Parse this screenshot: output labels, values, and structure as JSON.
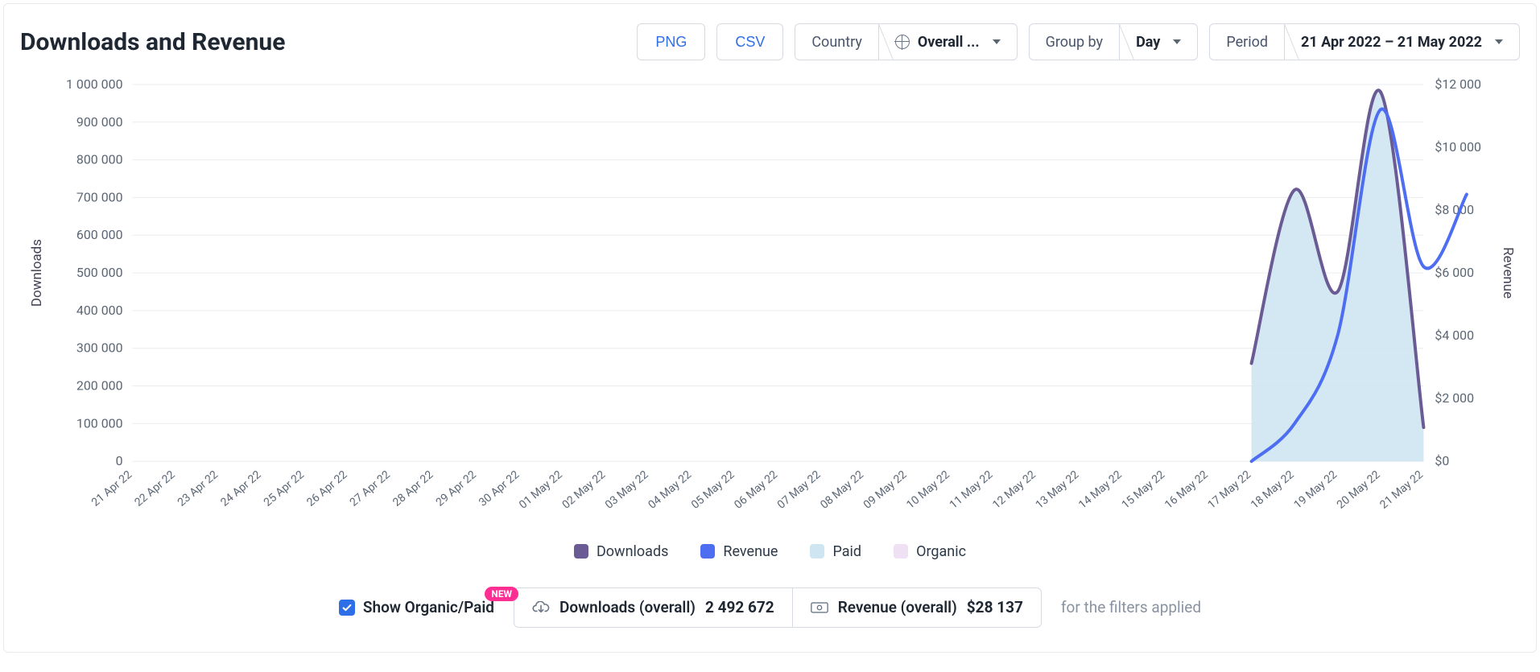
{
  "header": {
    "title": "Downloads and Revenue",
    "export_png": "PNG",
    "export_csv": "CSV",
    "country_label": "Country",
    "country_value": "Overall ...",
    "groupby_label": "Group by",
    "groupby_value": "Day",
    "period_label": "Period",
    "period_value": "21 Apr 2022 – 21 May 2022"
  },
  "chart_data": {
    "type": "line",
    "xlabel": "",
    "y_left_label": "Downloads",
    "y_right_label": "Revenue",
    "y_left_ticks": [
      0,
      100000,
      200000,
      300000,
      400000,
      500000,
      600000,
      700000,
      800000,
      900000,
      1000000
    ],
    "y_left_tick_labels": [
      "0",
      "100 000",
      "200 000",
      "300 000",
      "400 000",
      "500 000",
      "600 000",
      "700 000",
      "800 000",
      "900 000",
      "1 000 000"
    ],
    "y_right_ticks": [
      0,
      2000,
      4000,
      6000,
      8000,
      10000,
      12000
    ],
    "y_right_tick_labels": [
      "$0",
      "$2 000",
      "$4 000",
      "$6 000",
      "$8 000",
      "$10 000",
      "$12 000"
    ],
    "ylim_left": [
      0,
      1000000
    ],
    "ylim_right": [
      0,
      12000
    ],
    "categories": [
      "21 Apr 22",
      "22 Apr 22",
      "23 Apr 22",
      "24 Apr 22",
      "25 Apr 22",
      "26 Apr 22",
      "27 Apr 22",
      "28 Apr 22",
      "29 Apr 22",
      "30 Apr 22",
      "01 May 22",
      "02 May 22",
      "03 May 22",
      "04 May 22",
      "05 May 22",
      "06 May 22",
      "07 May 22",
      "08 May 22",
      "09 May 22",
      "10 May 22",
      "11 May 22",
      "12 May 22",
      "13 May 22",
      "14 May 22",
      "15 May 22",
      "16 May 22",
      "17 May 22",
      "18 May 22",
      "19 May 22",
      "20 May 22",
      "21 May 22"
    ],
    "series": [
      {
        "name": "Downloads",
        "axis": "left",
        "color": "#6b5b95",
        "values": [
          null,
          null,
          null,
          null,
          null,
          null,
          null,
          null,
          null,
          null,
          null,
          null,
          null,
          null,
          null,
          null,
          null,
          null,
          null,
          null,
          null,
          null,
          null,
          null,
          null,
          null,
          260000,
          720000,
          450000,
          980000,
          90000
        ]
      },
      {
        "name": "Revenue",
        "axis": "right",
        "color": "#4e6ef2",
        "values": [
          null,
          null,
          null,
          null,
          null,
          null,
          null,
          null,
          null,
          null,
          null,
          null,
          null,
          null,
          null,
          null,
          null,
          null,
          null,
          null,
          null,
          null,
          null,
          null,
          null,
          null,
          0,
          1200,
          4000,
          11200,
          6200,
          8500
        ]
      },
      {
        "name": "Paid",
        "axis": "left",
        "color": "#cfe6f2",
        "fill": true,
        "values": [
          null,
          null,
          null,
          null,
          null,
          null,
          null,
          null,
          null,
          null,
          null,
          null,
          null,
          null,
          null,
          null,
          null,
          null,
          null,
          null,
          null,
          null,
          null,
          null,
          null,
          null,
          260000,
          720000,
          450000,
          980000,
          90000
        ]
      },
      {
        "name": "Organic",
        "axis": "left",
        "color": "#efe0f4",
        "fill": true,
        "values": [
          null,
          null,
          null,
          null,
          null,
          null,
          null,
          null,
          null,
          null,
          null,
          null,
          null,
          null,
          null,
          null,
          null,
          null,
          null,
          null,
          null,
          null,
          null,
          null,
          null,
          null,
          0,
          0,
          0,
          0,
          0
        ]
      }
    ],
    "legend": [
      "Downloads",
      "Revenue",
      "Paid",
      "Organic"
    ]
  },
  "legend_colors": {
    "Downloads": "#6b5b95",
    "Revenue": "#4e6ef2",
    "Paid": "#cfe6f2",
    "Organic": "#efe0f4"
  },
  "footer": {
    "toggle_label": "Show Organic/Paid",
    "toggle_checked": true,
    "new_badge": "NEW",
    "downloads_label": "Downloads (overall)",
    "downloads_value": "2 492 672",
    "revenue_label": "Revenue (overall)",
    "revenue_value": "$28 137",
    "filters_note": "for the filters applied"
  }
}
